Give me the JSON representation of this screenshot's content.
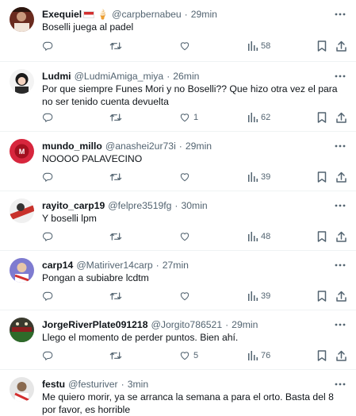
{
  "tweets": [
    {
      "name": "Exequiel",
      "handle": "@carpbernabeu",
      "time": "29min",
      "text": "Boselli juega al padel",
      "replies": "",
      "retweets": "",
      "likes": "",
      "views": "58",
      "avatar_color": "#6a2b1f"
    },
    {
      "name": "Ludmi",
      "handle": "@LudmiAmiga_miya",
      "time": "26min",
      "text": "Por que siempre Funes Mori y no Boselli?? Que hizo otra vez el para no ser tenido cuenta devuelta",
      "replies": "",
      "retweets": "",
      "likes": "1",
      "views": "62",
      "avatar_color": "#f3f3f3"
    },
    {
      "name": "mundo_millo",
      "handle": "@anashei2ur73i",
      "time": "29min",
      "text": "NOOOO PALAVECINO",
      "replies": "",
      "retweets": "",
      "likes": "",
      "views": "39",
      "avatar_color": "#d7263d"
    },
    {
      "name": "rayito_carp19",
      "handle": "@felpre3519fg",
      "time": "30min",
      "text": "Y boselli lpm",
      "replies": "",
      "retweets": "",
      "likes": "",
      "views": "48",
      "avatar_color": "#c8312b"
    },
    {
      "name": "carp14",
      "handle": "@Matiriver14carp",
      "time": "27min",
      "text": "Pongan a subiabre lcdtm",
      "replies": "",
      "retweets": "",
      "likes": "",
      "views": "39",
      "avatar_color": "#7e7bd0"
    },
    {
      "name": "JorgeRiverPlate091218",
      "handle": "@Jorgito786521",
      "time": "29min",
      "text": "Llego el momento de perder puntos. Bien ahí.",
      "replies": "",
      "retweets": "",
      "likes": "5",
      "views": "76",
      "avatar_color": "#3a3a2e"
    },
    {
      "name": "festu",
      "handle": "@festuriver",
      "time": "3min",
      "text": "Me quiero morir, ya se arranca la semana a para el orto. Basta del 8 por favor, es horrible",
      "replies": "",
      "retweets": "",
      "likes": "",
      "views": "",
      "avatar_color": "#e6e6e6"
    }
  ],
  "icons": {
    "reply": "reply-icon",
    "retweet": "retweet-icon",
    "like": "heart-icon",
    "views": "views-icon",
    "bookmark": "bookmark-icon",
    "share": "share-icon",
    "more": "more-icon"
  },
  "colors": {
    "text": "#0f1419",
    "secondary": "#536471",
    "divider": "#eff3f4"
  }
}
